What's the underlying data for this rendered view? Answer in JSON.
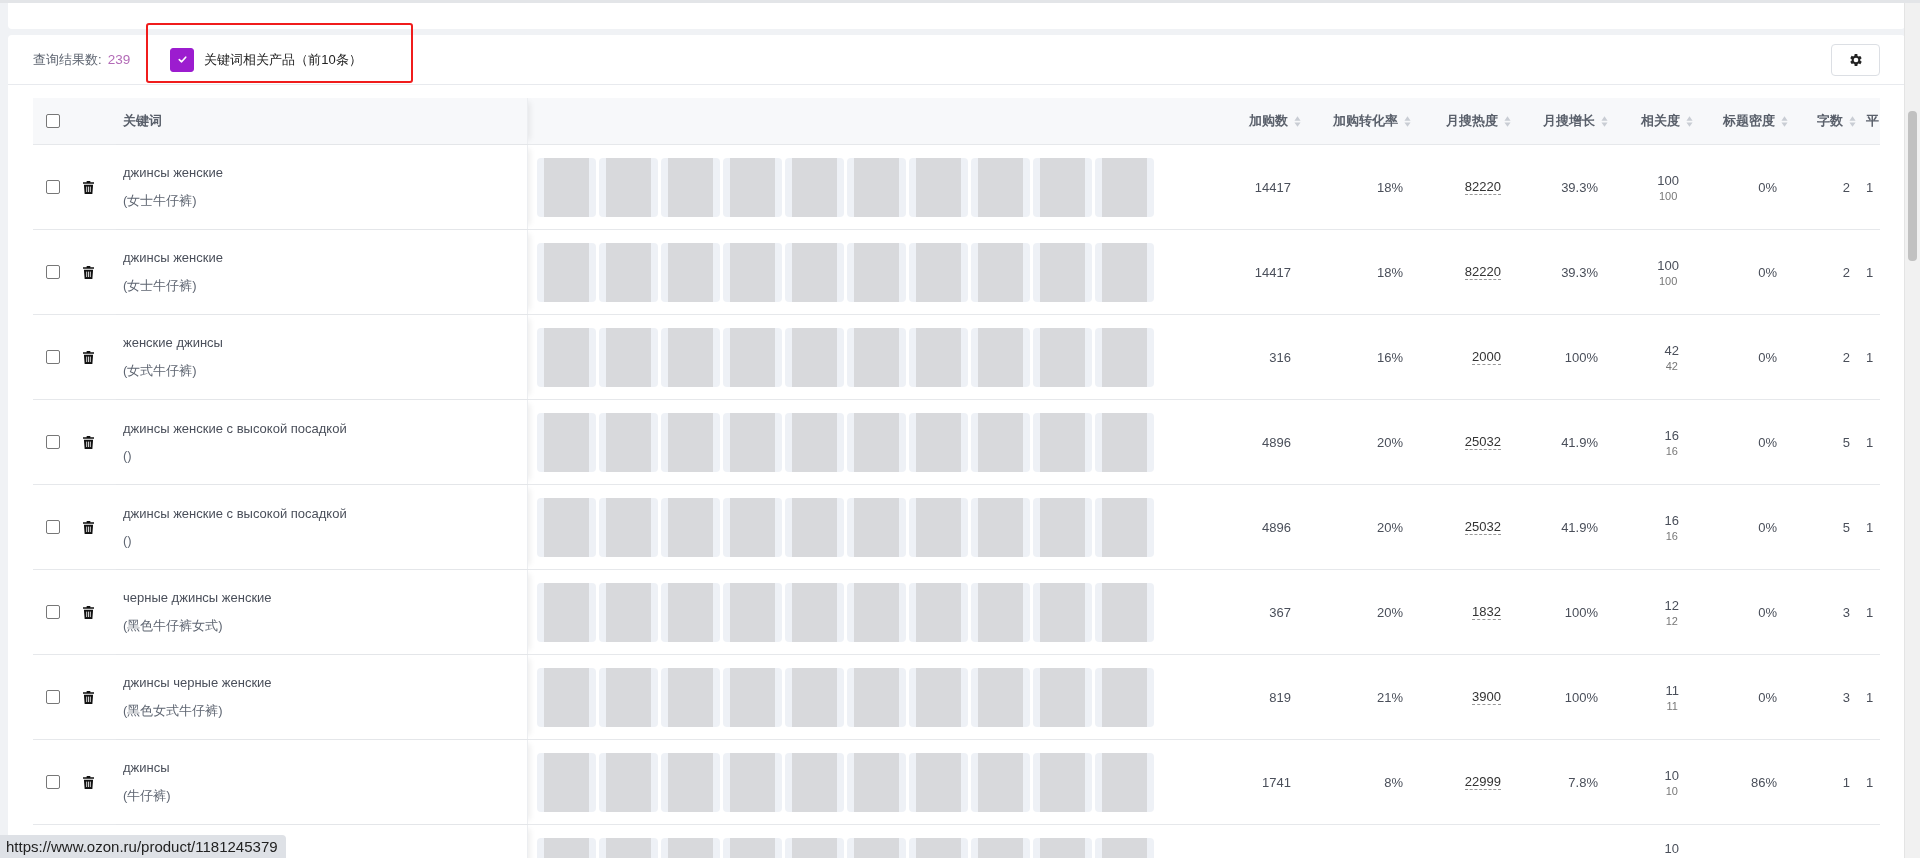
{
  "toolbar": {
    "result_label": "查询结果数:",
    "result_count": "239",
    "related_products": {
      "label": "关键词相关产品（前10条）",
      "checked": true
    }
  },
  "table": {
    "header_checked": false,
    "keyword_header": "关键词",
    "columns": [
      {
        "label": "加购数",
        "sortable": true
      },
      {
        "label": "加购转化率",
        "sortable": true
      },
      {
        "label": "月搜热度",
        "sortable": true
      },
      {
        "label": "月搜增长",
        "sortable": true
      },
      {
        "label": "相关度",
        "sortable": true
      },
      {
        "label": "标题密度",
        "sortable": true
      },
      {
        "label": "字数",
        "sortable": true
      },
      {
        "label": "平",
        "sortable": false
      }
    ],
    "rows": [
      {
        "checked": false,
        "keyword": "джинсы женские",
        "translation": "(女士牛仔裤)",
        "add_to_cart": "14417",
        "conversion": "18%",
        "monthly_search": "82220",
        "growth": "39.3%",
        "relevance": "100",
        "relevance_sub": "100",
        "title_density": "0%",
        "words": "2",
        "column_9": "1"
      },
      {
        "checked": false,
        "keyword": "джинсы женские",
        "translation": "(女士牛仔裤)",
        "add_to_cart": "14417",
        "conversion": "18%",
        "monthly_search": "82220",
        "growth": "39.3%",
        "relevance": "100",
        "relevance_sub": "100",
        "title_density": "0%",
        "words": "2",
        "column_9": "1"
      },
      {
        "checked": false,
        "keyword": "женские джинсы",
        "translation": "(女式牛仔裤)",
        "add_to_cart": "316",
        "conversion": "16%",
        "monthly_search": "2000",
        "growth": "100%",
        "relevance": "42",
        "relevance_sub": "42",
        "title_density": "0%",
        "words": "2",
        "column_9": "1"
      },
      {
        "checked": false,
        "keyword": "джинсы женские с высокой посадкой",
        "translation": "()",
        "add_to_cart": "4896",
        "conversion": "20%",
        "monthly_search": "25032",
        "growth": "41.9%",
        "relevance": "16",
        "relevance_sub": "16",
        "title_density": "0%",
        "words": "5",
        "column_9": "1"
      },
      {
        "checked": false,
        "keyword": "джинсы женские с высокой посадкой",
        "translation": "()",
        "add_to_cart": "4896",
        "conversion": "20%",
        "monthly_search": "25032",
        "growth": "41.9%",
        "relevance": "16",
        "relevance_sub": "16",
        "title_density": "0%",
        "words": "5",
        "column_9": "1"
      },
      {
        "checked": false,
        "keyword": "черные джинсы женские",
        "translation": "(黑色牛仔裤女式)",
        "add_to_cart": "367",
        "conversion": "20%",
        "monthly_search": "1832",
        "growth": "100%",
        "relevance": "12",
        "relevance_sub": "12",
        "title_density": "0%",
        "words": "3",
        "column_9": "1"
      },
      {
        "checked": false,
        "keyword": "джинсы черные женские",
        "translation": "(黑色女式牛仔裤)",
        "add_to_cart": "819",
        "conversion": "21%",
        "monthly_search": "3900",
        "growth": "100%",
        "relevance": "11",
        "relevance_sub": "11",
        "title_density": "0%",
        "words": "3",
        "column_9": "1"
      },
      {
        "checked": false,
        "keyword": "джинсы",
        "translation": "(牛仔裤)",
        "add_to_cart": "1741",
        "conversion": "8%",
        "monthly_search": "22999",
        "growth": "7.8%",
        "relevance": "10",
        "relevance_sub": "10",
        "title_density": "86%",
        "words": "1",
        "column_9": "1"
      },
      {
        "relevance": "10"
      }
    ]
  },
  "status_link": "https://www.ozon.ru/product/1181245379"
}
